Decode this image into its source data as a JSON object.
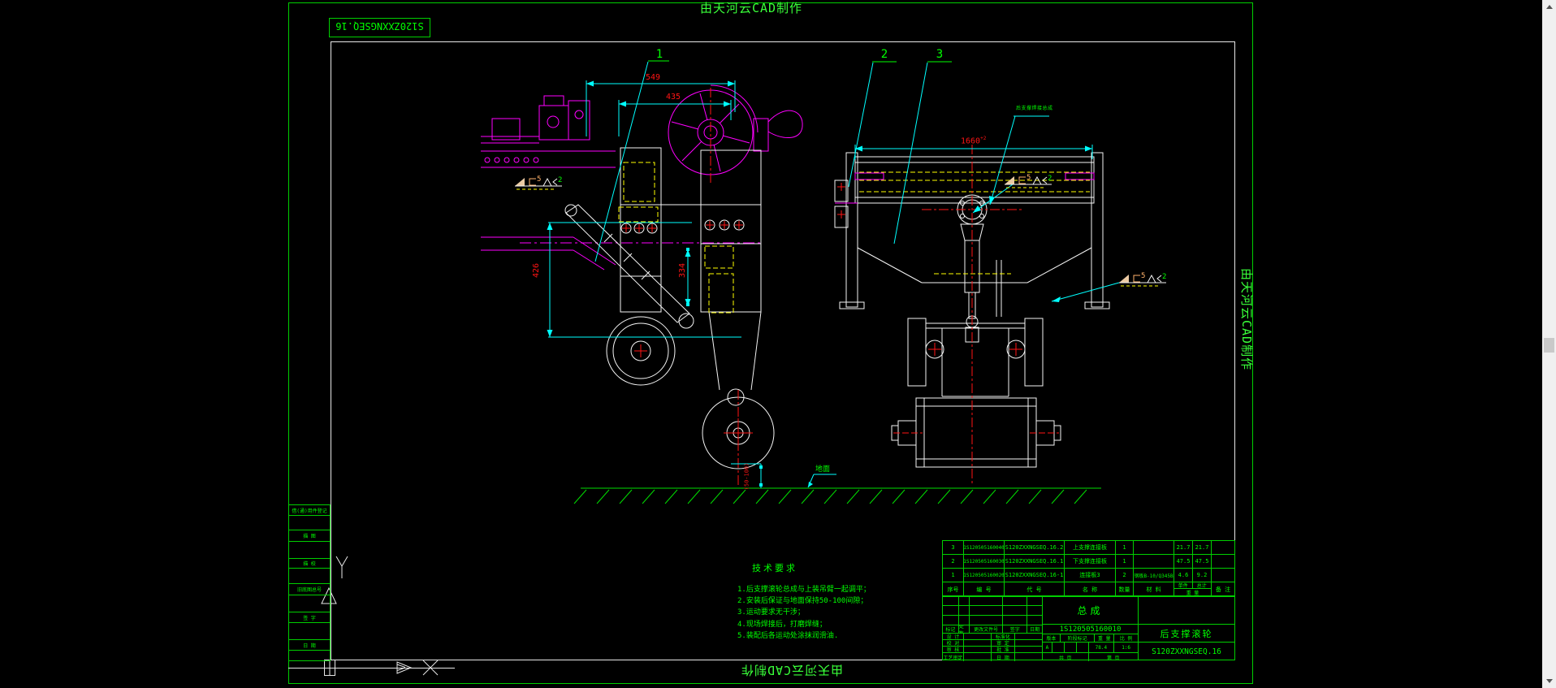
{
  "watermarks": {
    "top": "由天河云CAD制作",
    "bottom": "由天河云CAD制作",
    "right": "由天河云CAD制作"
  },
  "sheet": {
    "code_box": "S120ZXXNGSEQ.16"
  },
  "margin_strip": {
    "labels": [
      "借(通)用件登记",
      "描 图",
      "描 校",
      "旧底图总号",
      "签 字",
      "日 期"
    ]
  },
  "balloons": {
    "b1": "1",
    "b2": "2",
    "b3": "3"
  },
  "dimensions": {
    "d549": "549",
    "d435": "435",
    "d426": "426",
    "d334": "334",
    "gap": "(50-100)",
    "d1660": "1660",
    "d1660_tol": "+2"
  },
  "annotations": {
    "ground": "地面",
    "weld_note": "后支撑焊接总成",
    "weld_size": "5",
    "weld_qty": "2"
  },
  "tech_req": {
    "title": "技术要求",
    "items": [
      "1.后支撑滚轮总成与上装吊臂一起调平；",
      "2.安装后保证与地面保持50-100间隙；",
      "3.运动要求无干涉；",
      "4.现场焊接后，打磨焊缝；",
      "5.装配后各运动处涂抹润滑油."
    ]
  },
  "bom": {
    "headers": {
      "seq": "序号",
      "code": "编 号",
      "dwg": "代 号",
      "name": "名 称",
      "qty": "数量",
      "material": "材 料",
      "unit": "单件",
      "total": "总计",
      "weight": "重 量",
      "remark": "备 注"
    },
    "rows": [
      {
        "seq": "3",
        "code": "1S120505160040",
        "dwg": "S120ZXXNGSEQ.16.2",
        "name": "上支撑连接板",
        "qty": "1",
        "material": "",
        "unit": "21.7",
        "total": "21.7",
        "remark": ""
      },
      {
        "seq": "2",
        "code": "1S120505160030",
        "dwg": "S120ZXXNGSEQ.16.1",
        "name": "下支撑连接板",
        "qty": "1",
        "material": "",
        "unit": "47.5",
        "total": "47.5",
        "remark": ""
      },
      {
        "seq": "1",
        "code": "1S120505160020",
        "dwg": "S120ZXXNGSEQ.16-1",
        "name": "连接板3",
        "qty": "2",
        "material": "钢板B-10/Q345B",
        "unit": "4.6",
        "total": "9.2",
        "remark": ""
      }
    ]
  },
  "title_block": {
    "change_row": {
      "mark": "标记",
      "count": "处数",
      "doc_no": "更改文件号",
      "sign": "签字",
      "date": "日期"
    },
    "sig_rows": [
      {
        "l": "设 计",
        "r": "标准化"
      },
      {
        "l": "校 对",
        "r": "审 定"
      },
      {
        "l": "审 核",
        "r": "批 准"
      },
      {
        "l": "工艺审定",
        "r": "日 期"
      }
    ],
    "assembly": "总成",
    "assembly_no": "1S120505160010",
    "version_label": "版本",
    "version": "A",
    "stage_label": "阶段标记",
    "weight_label": "重 量",
    "weight": "78.4",
    "scale_label": "比 例",
    "scale": "1:6",
    "sheets": "共 页",
    "sheet_no": "第 页",
    "part_name": "后支撑滚轮",
    "part_code": "S120ZXXNGSEQ.16"
  }
}
